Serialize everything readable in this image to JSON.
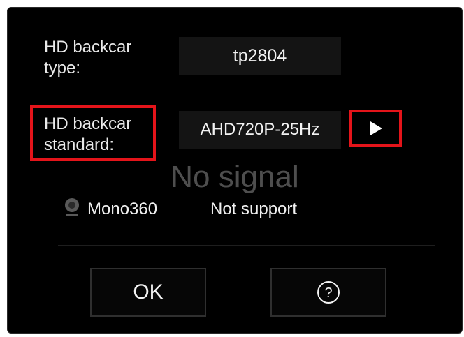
{
  "dialog": {
    "type_label": "HD backcar\ntype:",
    "type_value": "tp2804",
    "standard_label": "HD backcar\nstandard:",
    "standard_value": "AHD720P-25Hz",
    "next_icon": "play-right-triangle",
    "status_text": "No signal",
    "mono_icon": "camera-icon",
    "mono_label": "Mono360",
    "mono_value": "Not support",
    "ok_label": "OK",
    "help_icon": "question-circle-icon",
    "highlight_color": "#e4141a"
  }
}
